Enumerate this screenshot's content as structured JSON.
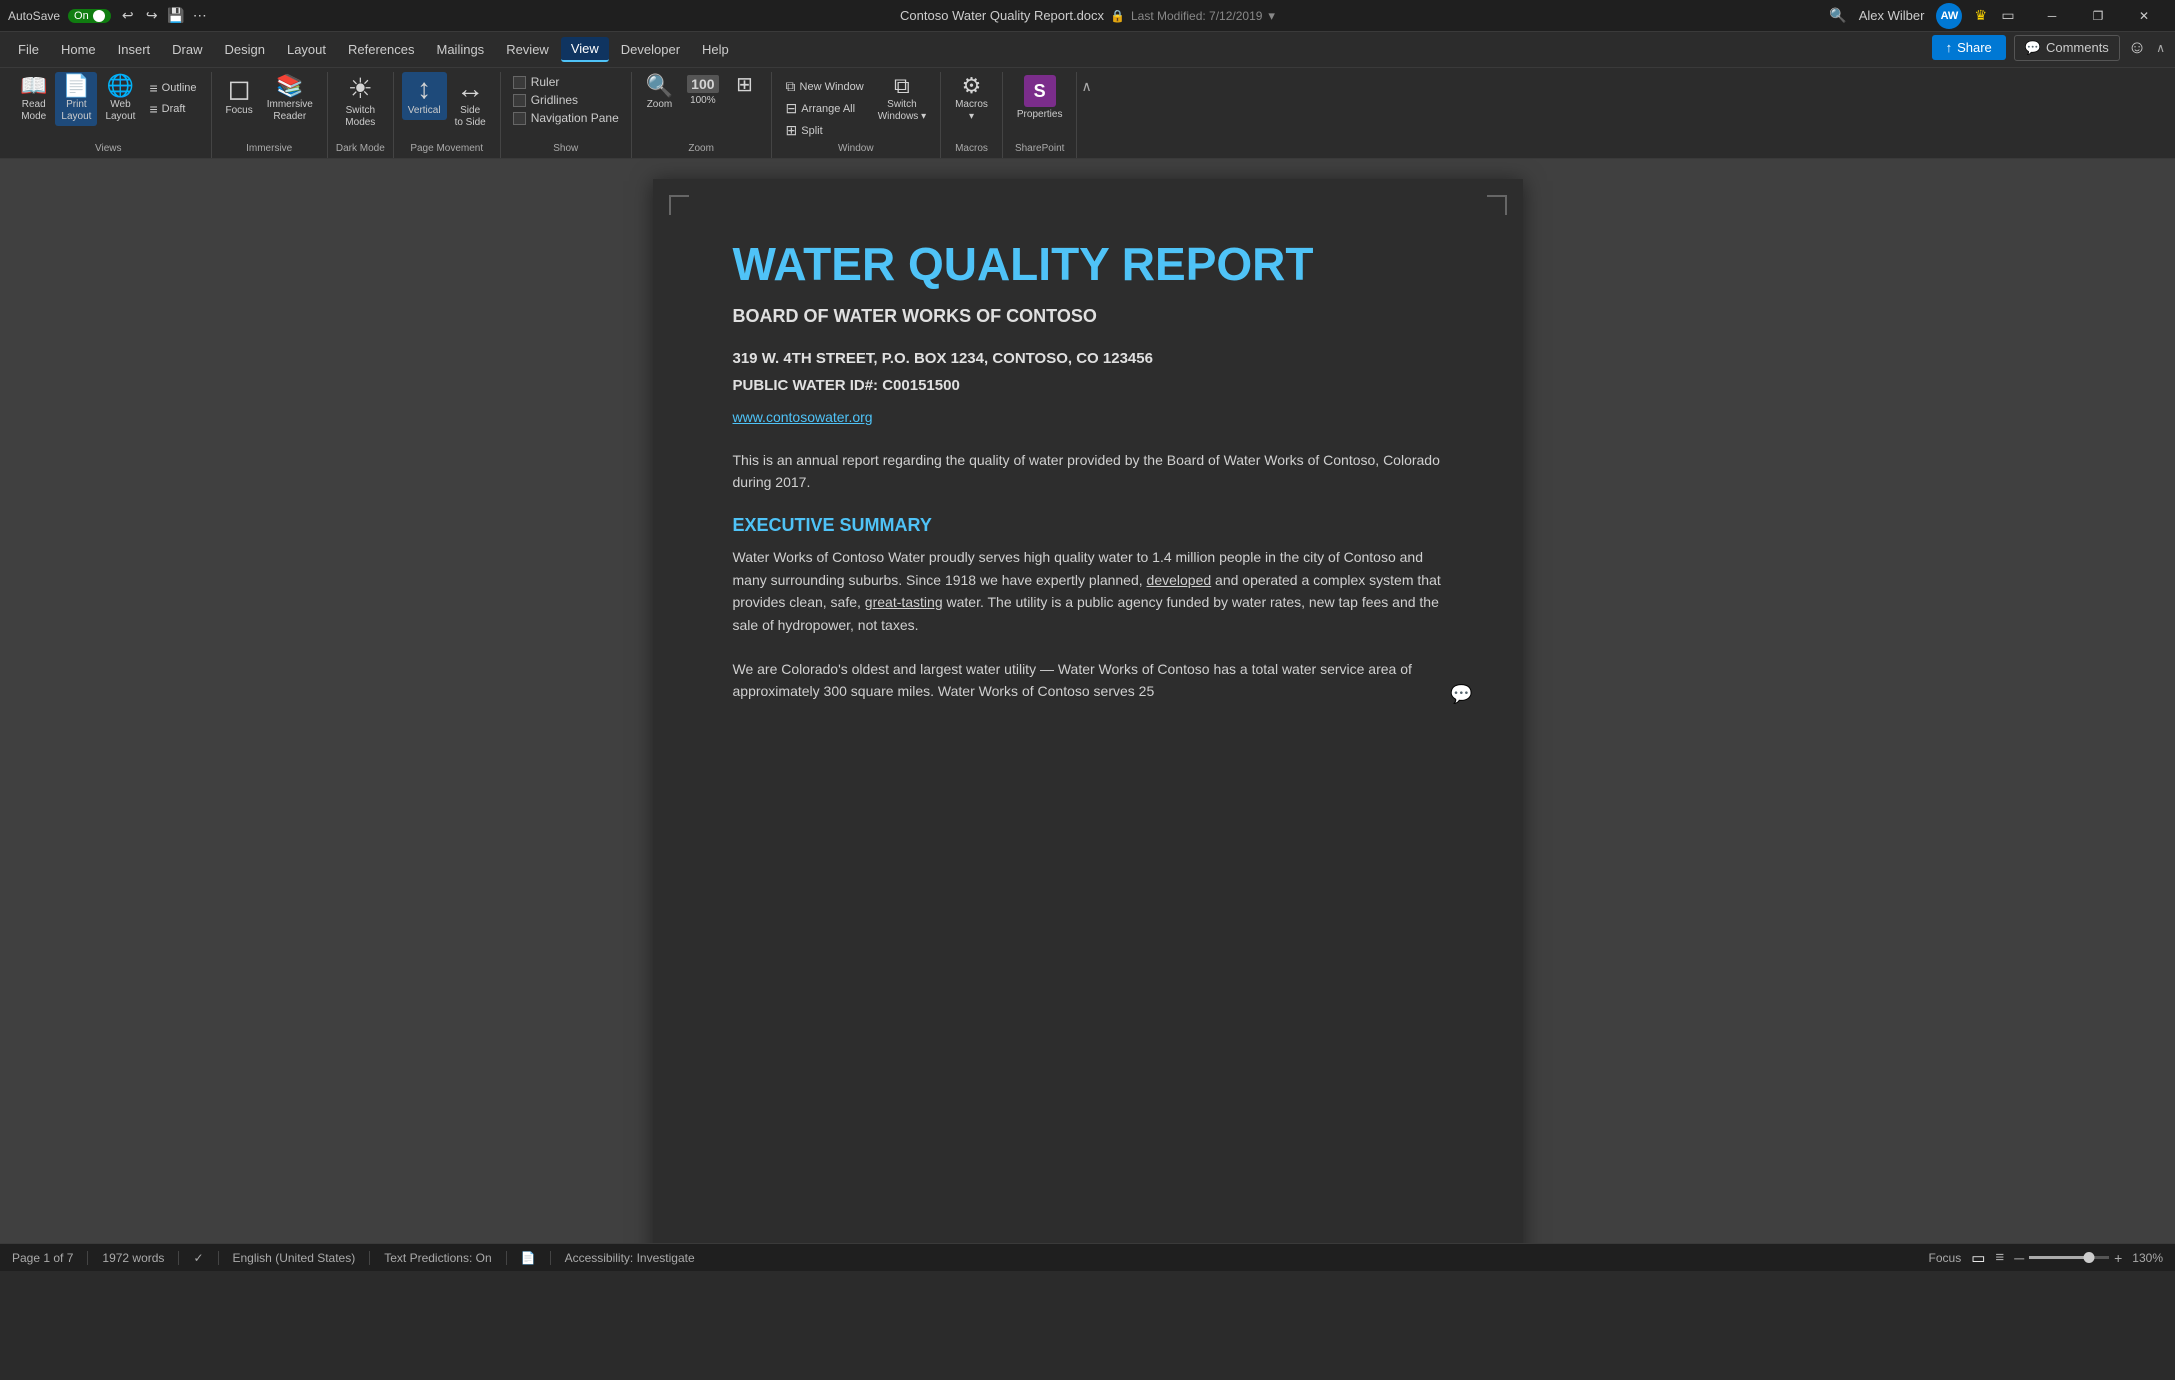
{
  "titlebar": {
    "autosave_label": "AutoSave",
    "autosave_state": "On",
    "filename": "Contoso Water Quality Report.docx",
    "last_modified": "Last Modified: 7/12/2019",
    "user_name": "Alex Wilber",
    "user_initials": "AW",
    "minimize_label": "─",
    "restore_label": "❐",
    "close_label": "✕"
  },
  "menubar": {
    "items": [
      {
        "label": "File"
      },
      {
        "label": "Home"
      },
      {
        "label": "Insert"
      },
      {
        "label": "Draw"
      },
      {
        "label": "Design"
      },
      {
        "label": "Layout"
      },
      {
        "label": "References"
      },
      {
        "label": "Mailings"
      },
      {
        "label": "Review"
      },
      {
        "label": "View",
        "active": true
      },
      {
        "label": "Developer"
      },
      {
        "label": "Help"
      }
    ]
  },
  "ribbon": {
    "share_label": "Share",
    "comments_label": "Comments",
    "groups": [
      {
        "name": "views",
        "label": "Views",
        "buttons": [
          {
            "id": "read-mode",
            "icon": "📖",
            "label": "Read\nMode"
          },
          {
            "id": "print-layout",
            "icon": "📄",
            "label": "Print\nLayout",
            "active": true
          },
          {
            "id": "web-layout",
            "icon": "🌐",
            "label": "Web\nLayout"
          }
        ],
        "small_buttons": [
          {
            "id": "outline",
            "label": "Outline"
          },
          {
            "id": "draft",
            "label": "Draft"
          }
        ]
      },
      {
        "name": "immersive",
        "label": "Immersive",
        "buttons": [
          {
            "id": "focus",
            "icon": "◻",
            "label": "Focus"
          },
          {
            "id": "immersive-reader",
            "icon": "📚",
            "label": "Immersive\nReader"
          }
        ]
      },
      {
        "name": "dark-mode",
        "label": "Dark Mode",
        "buttons": [
          {
            "id": "switch-modes",
            "icon": "☀",
            "label": "Switch\nModes"
          }
        ]
      },
      {
        "name": "page-movement",
        "label": "Page Movement",
        "buttons": [
          {
            "id": "vertical",
            "icon": "↕",
            "label": "Vertical",
            "active": true
          },
          {
            "id": "side-to-side",
            "icon": "↔",
            "label": "Side\nto Side"
          }
        ]
      },
      {
        "name": "show",
        "label": "Show",
        "checkboxes": [
          {
            "id": "ruler",
            "label": "Ruler",
            "checked": false
          },
          {
            "id": "gridlines",
            "label": "Gridlines",
            "checked": false
          },
          {
            "id": "navigation-pane",
            "label": "Navigation Pane",
            "checked": false
          }
        ]
      },
      {
        "name": "zoom",
        "label": "Zoom",
        "buttons": [
          {
            "id": "zoom-btn",
            "icon": "🔍",
            "label": "Zoom"
          },
          {
            "id": "zoom-100",
            "icon": "100",
            "label": "100%"
          },
          {
            "id": "zoom-page",
            "icon": "⊞",
            "label": ""
          }
        ]
      },
      {
        "name": "window",
        "label": "Window",
        "buttons": [
          {
            "id": "switch-windows",
            "icon": "⧉",
            "label": "Switch\nWindows ▾"
          }
        ],
        "small_buttons": [
          {
            "id": "new-window",
            "label": "New Window"
          },
          {
            "id": "arrange-all",
            "label": "Arrange All"
          },
          {
            "id": "split",
            "label": "Split"
          }
        ]
      },
      {
        "name": "macros-group",
        "label": "Macros",
        "buttons": [
          {
            "id": "macros",
            "icon": "⚙",
            "label": "Macros\n▾"
          }
        ]
      },
      {
        "name": "sharepoint",
        "label": "SharePoint",
        "buttons": [
          {
            "id": "properties",
            "icon": "S",
            "label": "Properties"
          }
        ]
      }
    ]
  },
  "document": {
    "title": "WATER QUALITY REPORT",
    "subtitle": "BOARD OF WATER WORKS OF CONTOSO",
    "address_line1": "319 W. 4TH STREET, P.O. BOX 1234, CONTOSO, CO 123456",
    "address_line2": "PUBLIC WATER ID#: C00151500",
    "website": "www.contosowater.org",
    "intro": "This is an annual report regarding the quality of water provided by the Board of Water Works of Contoso, Colorado during 2017.",
    "executive_summary_title": "EXECUTIVE SUMMARY",
    "executive_summary_body1": "Water Works of Contoso Water proudly serves high quality water to 1.4 million people in the city of Contoso and many surrounding suburbs. Since 1918 we have expertly planned, developed and operated a complex system that provides clean, safe, great-tasting water. The utility is a public agency funded by water rates, new tap fees and the sale of hydropower, not taxes.",
    "executive_summary_body2": "We are Colorado's oldest and largest water utility — Water Works of Contoso has a total water service area of approximately 300 square miles. Water Works of Contoso serves 25"
  },
  "statusbar": {
    "page": "Page 1 of 7",
    "words": "1972 words",
    "language": "English (United States)",
    "text_predictions": "Text Predictions: On",
    "accessibility": "Accessibility: Investigate",
    "focus": "Focus",
    "zoom_level": "130%",
    "zoom_minus": "─",
    "zoom_plus": "+"
  }
}
